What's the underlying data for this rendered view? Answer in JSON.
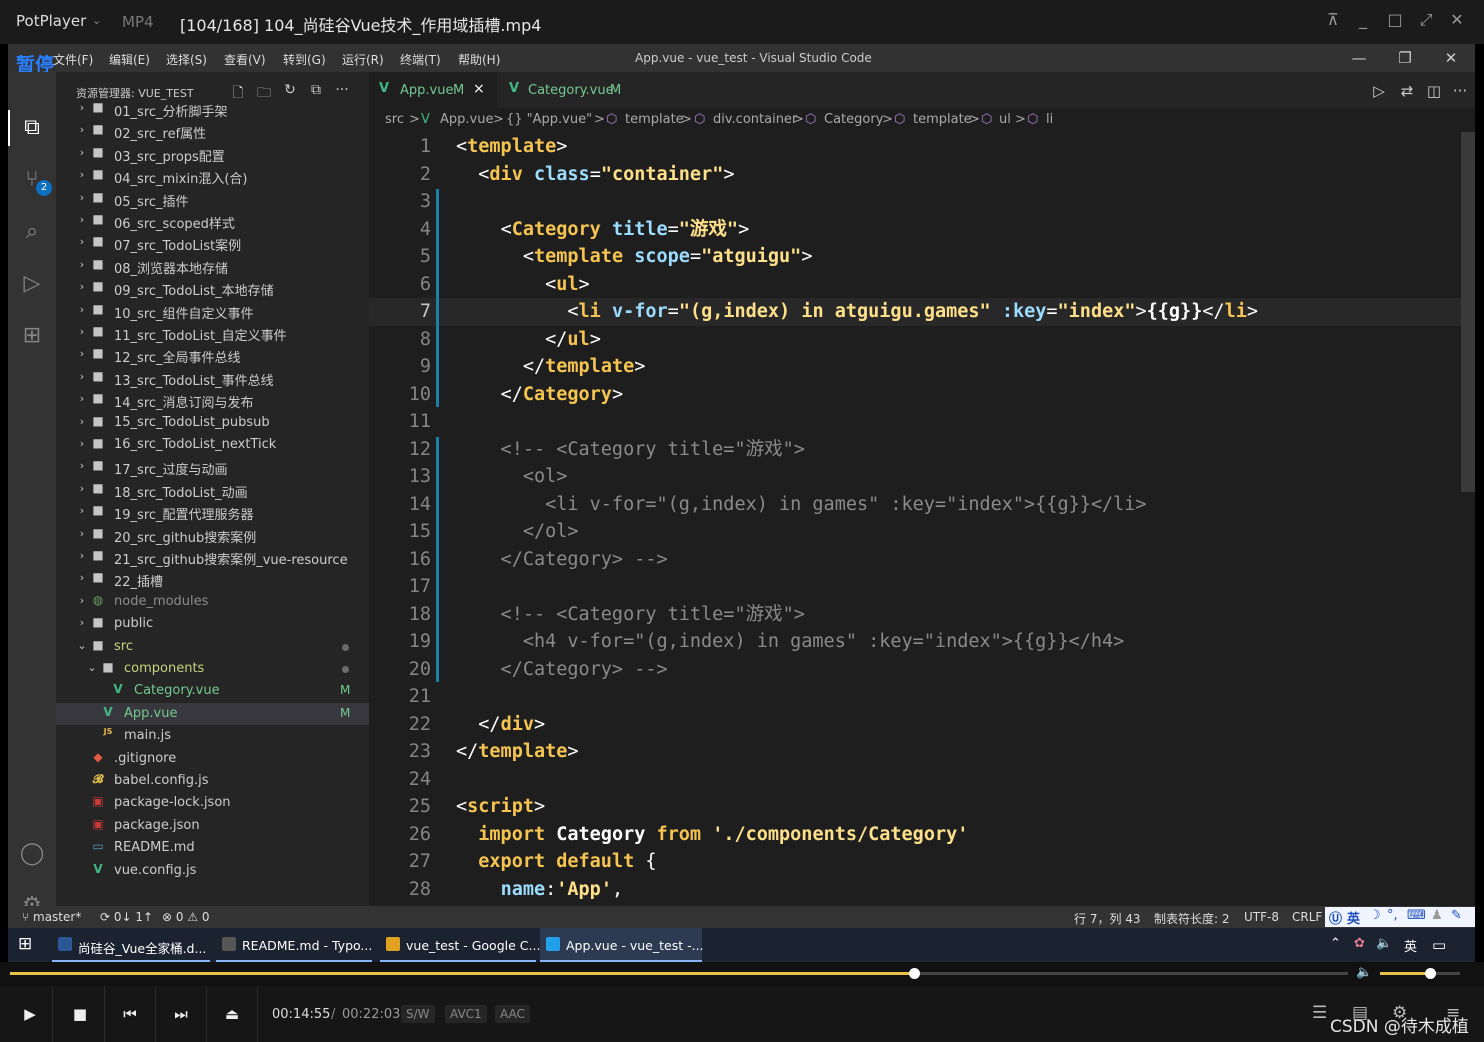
{
  "player": {
    "brand": "PotPlayer",
    "format": "MP4",
    "file_title": "[104/168] 104_尚硅谷Vue技术_作用域插槽.mp4",
    "paused_label": "暂停",
    "time_current": "00:14:55",
    "time_sep": "/",
    "time_total": "00:22:03",
    "chips": [
      "S/W",
      "AVC1",
      "AAC"
    ],
    "progress_percent": 67.6,
    "volume_percent": 62
  },
  "vscode": {
    "menu": [
      "文件(F)",
      "编辑(E)",
      "选择(S)",
      "查看(V)",
      "转到(G)",
      "运行(R)",
      "终端(T)",
      "帮助(H)"
    ],
    "window_title": "App.vue - vue_test - Visual Studio Code",
    "explorer_title": "资源管理器: VUE_TEST",
    "scm_badge": "2",
    "tree": [
      {
        "label": "01_src_分析脚手架",
        "type": "folder"
      },
      {
        "label": "02_src_ref属性",
        "type": "folder"
      },
      {
        "label": "03_src_props配置",
        "type": "folder"
      },
      {
        "label": "04_src_mixin混入(合)",
        "type": "folder"
      },
      {
        "label": "05_src_插件",
        "type": "folder"
      },
      {
        "label": "06_src_scoped样式",
        "type": "folder"
      },
      {
        "label": "07_src_TodoList案例",
        "type": "folder"
      },
      {
        "label": "08_浏览器本地存储",
        "type": "folder"
      },
      {
        "label": "09_src_TodoList_本地存储",
        "type": "folder"
      },
      {
        "label": "10_src_组件自定义事件",
        "type": "folder"
      },
      {
        "label": "11_src_TodoList_自定义事件",
        "type": "folder"
      },
      {
        "label": "12_src_全局事件总线",
        "type": "folder"
      },
      {
        "label": "13_src_TodoList_事件总线",
        "type": "folder"
      },
      {
        "label": "14_src_消息订阅与发布",
        "type": "folder"
      },
      {
        "label": "15_src_TodoList_pubsub",
        "type": "folder"
      },
      {
        "label": "16_src_TodoList_nextTick",
        "type": "folder"
      },
      {
        "label": "17_src_过度与动画",
        "type": "folder"
      },
      {
        "label": "18_src_TodoList_动画",
        "type": "folder"
      },
      {
        "label": "19_src_配置代理服务器",
        "type": "folder"
      },
      {
        "label": "20_src_github搜索案例",
        "type": "folder"
      },
      {
        "label": "21_src_github搜索案例_vue-resource",
        "type": "folder"
      },
      {
        "label": "22_插槽",
        "type": "folder"
      },
      {
        "label": "node_modules",
        "type": "folder-dim"
      },
      {
        "label": "public",
        "type": "folder"
      },
      {
        "label": "src",
        "type": "folder-open"
      },
      {
        "label": "components",
        "type": "folder-open"
      },
      {
        "label": "Category.vue",
        "type": "vue",
        "badge": "M"
      },
      {
        "label": "App.vue",
        "type": "vue",
        "badge": "M"
      },
      {
        "label": "main.js",
        "type": "js"
      },
      {
        "label": ".gitignore",
        "type": "git"
      },
      {
        "label": "babel.config.js",
        "type": "babel"
      },
      {
        "label": "package-lock.json",
        "type": "pkg"
      },
      {
        "label": "package.json",
        "type": "pkg"
      },
      {
        "label": "README.md",
        "type": "md"
      },
      {
        "label": "vue.config.js",
        "type": "vue"
      }
    ],
    "tabs": [
      {
        "label": "App.vue",
        "mod": "M",
        "close": "×"
      },
      {
        "label": "Category.vue",
        "mod": "M"
      }
    ],
    "breadcrumbs": [
      "src",
      ">",
      "App.vue",
      ">",
      "{} \"App.vue\"",
      ">",
      "template",
      ">",
      "div.container",
      ">",
      "Category",
      ">",
      "template",
      ">",
      "ul",
      ">",
      "li"
    ],
    "code_lines": [
      "<template>",
      "  <div class=\"container\">",
      "",
      "    <Category title=\"游戏\">",
      "      <template scope=\"atguigu\">",
      "        <ul>",
      "          <li v-for=\"(g,index) in atguigu.games\" :key=\"index\">{{g}}</li>",
      "        </ul>",
      "      </template>",
      "    </Category>",
      "",
      "    <!-- <Category title=\"游戏\">",
      "      <ol>",
      "        <li v-for=\"(g,index) in games\" :key=\"index\">{{g}}</li>",
      "      </ol>",
      "    </Category> -->",
      "",
      "    <!-- <Category title=\"游戏\">",
      "      <h4 v-for=\"(g,index) in games\" :key=\"index\">{{g}}</h4>",
      "    </Category> -->",
      "",
      "  </div>",
      "</template>",
      "",
      "<script>",
      "  import Category from './components/Category'",
      "  export default {",
      "    name:'App',"
    ],
    "status": {
      "branch": "master*",
      "sync": "0↓ 1↑",
      "problems": "⊗ 0 ⚠ 0",
      "position": "行 7，列 43",
      "tab_size": "制表符长度: 2",
      "encoding": "UTF-8",
      "eol": "CRLF",
      "ime": "英"
    }
  },
  "taskbar": {
    "items": [
      {
        "label": "尚硅谷_Vue全家桶.d...",
        "color": "#2b5797"
      },
      {
        "label": "README.md - Typo...",
        "color": "#555555"
      },
      {
        "label": "vue_test - Google C...",
        "color": "#e0a020"
      },
      {
        "label": "App.vue - vue_test -...",
        "color": "#23a0ea"
      }
    ],
    "tray_ime": "英"
  },
  "watermark": "CSDN @待木成植"
}
